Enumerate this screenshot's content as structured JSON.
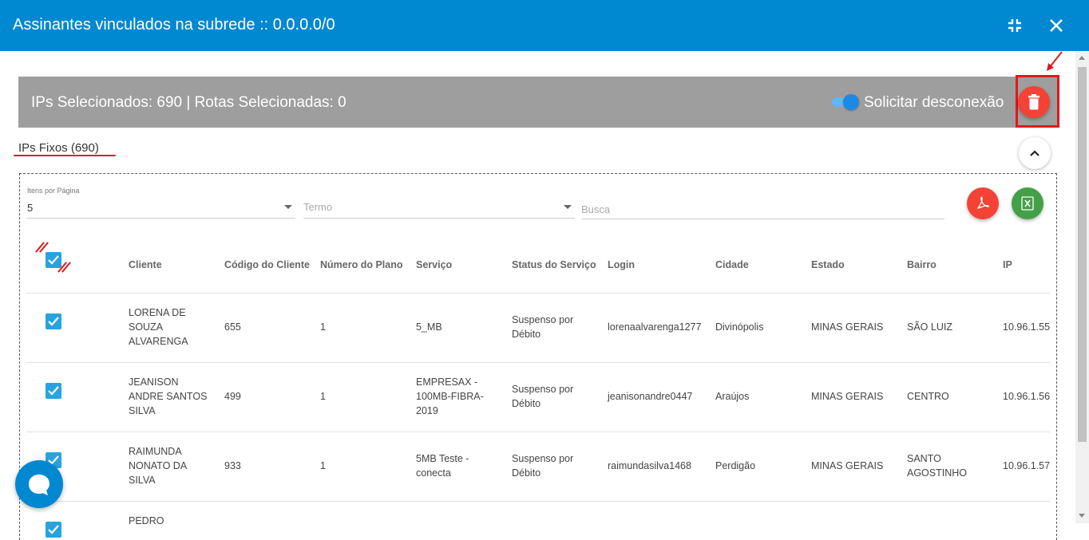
{
  "window": {
    "title": "Assinantes vinculados na subrede :: 0.0.0.0/0"
  },
  "summary": {
    "text": "IPs Selecionados: 690 | Rotas Selecionadas: 0",
    "toggle_label": "Solicitar desconexão",
    "toggle_on": true
  },
  "section": {
    "title": "IPs Fixos (690)"
  },
  "filters": {
    "items_per_page_label": "Itens por Página",
    "items_per_page_value": "5",
    "term_placeholder": "Termo",
    "search_placeholder": "Busca"
  },
  "table": {
    "columns": [
      "Cliente",
      "Código do Cliente",
      "Número do Plano",
      "Serviço",
      "Status do Serviço",
      "Login",
      "Cidade",
      "Estado",
      "Bairro",
      "IP"
    ],
    "rows": [
      {
        "cliente": [
          "LORENA DE",
          "SOUZA",
          "ALVARENGA"
        ],
        "codigo": "655",
        "plano": "1",
        "servico": [
          "5_MB"
        ],
        "status": [
          "Suspenso por",
          "Débito"
        ],
        "login": "lorenaalvarenga1277",
        "cidade": "Divinópolis",
        "estado": "MINAS GERAIS",
        "bairro": [
          "SÃO LUIZ"
        ],
        "ip": "10.96.1.55",
        "checked": true
      },
      {
        "cliente": [
          "JEANISON",
          "ANDRE SANTOS",
          "SILVA"
        ],
        "codigo": "499",
        "plano": "1",
        "servico": [
          "EMPRESAX -",
          "100MB-FIBRA-",
          "2019"
        ],
        "status": [
          "Suspenso por",
          "Débito"
        ],
        "login": "jeanisonandre0447",
        "cidade": "Araújos",
        "estado": "MINAS GERAIS",
        "bairro": [
          "CENTRO"
        ],
        "ip": "10.96.1.56",
        "checked": true
      },
      {
        "cliente": [
          "RAIMUNDA",
          "NONATO DA",
          "SILVA"
        ],
        "codigo": "933",
        "plano": "1",
        "servico": [
          "5MB Teste -",
          "conecta"
        ],
        "status": [
          "Suspenso por",
          "Débito"
        ],
        "login": "raimundasilva1468",
        "cidade": "Perdigão",
        "estado": "MINAS GERAIS",
        "bairro": [
          "SANTO",
          "AGOSTINHO"
        ],
        "ip": "10.96.1.57",
        "checked": true
      },
      {
        "cliente": [
          "PEDRO"
        ],
        "codigo": "",
        "plano": "",
        "servico": [
          ""
        ],
        "status": [
          ""
        ],
        "login": "",
        "cidade": "",
        "estado": "",
        "bairro": [
          ""
        ],
        "ip": "",
        "checked": true
      }
    ]
  },
  "colors": {
    "header": "#0088d1",
    "summary_bar": "#9e9e9e",
    "delete": "#f44336",
    "excel": "#43a047",
    "checkbox": "#29a3df",
    "annotation": "#e0191b"
  },
  "icons": [
    "minimize-icon",
    "close-icon",
    "trash-icon",
    "chevron-up-icon",
    "pdf-icon",
    "excel-icon",
    "check-icon",
    "chat-icon"
  ]
}
